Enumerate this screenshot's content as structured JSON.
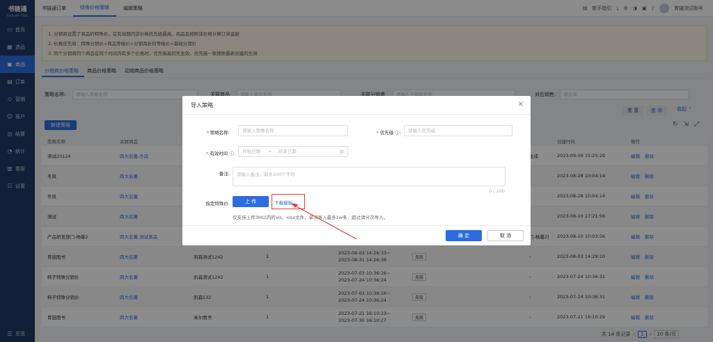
{
  "sidebar": {
    "logo_title": "书链通",
    "logo_sub": "SHULIAN TONG",
    "items": [
      {
        "label": "首页",
        "icon": "monitor-icon"
      },
      {
        "label": "选品",
        "icon": "grid-icon"
      },
      {
        "label": "商品",
        "icon": "box-icon"
      },
      {
        "label": "订单",
        "icon": "order-icon"
      },
      {
        "label": "营销",
        "icon": "marketing-icon"
      },
      {
        "label": "客户",
        "icon": "user-icon"
      },
      {
        "label": "结算",
        "icon": "settle-icon"
      },
      {
        "label": "统计",
        "icon": "chart-icon"
      },
      {
        "label": "看板",
        "icon": "board-icon"
      },
      {
        "label": "设置",
        "icon": "settings-icon"
      }
    ],
    "active_index": 2,
    "bottom_label": "总览"
  },
  "topbar": {
    "tabs": [
      "书链通订单",
      "特殊价格策略",
      "编辑策略"
    ],
    "active_tab": 1,
    "guide": "新手指引",
    "user": "育链测试账号"
  },
  "notice": [
    "1. 分销商设置了商品的特殊价，在有效期内该价格优先级最高，商品会按照该价格计算订单金额",
    "2. 价格优先级：特殊分销价>商品等级价>分销商折扣等级价>基础分销价",
    "3. 同个分销商同个商品在同个时间内有多个价格时，优先级高的先生效，优先级一致按照最新创建的生效"
  ],
  "subtabs": [
    "分销商价格策略",
    "商品价格策略",
    "动销商品价格策略"
  ],
  "search": {
    "name_label": "策略名称:",
    "name_ph": "请输入策略名称",
    "goods_label": "关联商品",
    "goods_ph": "请输入商品名称",
    "dist_label": "关联分销商",
    "dist_ph": "请输入分销商名称",
    "sales_label": "对应销售:",
    "sales_ph": "请选择"
  },
  "buttons": {
    "reset": "重 置",
    "query": "查 询",
    "collapse": "收起 ⌃",
    "new": "新建策略"
  },
  "table": {
    "headers": [
      "策略名称",
      "关联商品",
      "",
      "",
      "",
      "",
      "",
      "创建时间",
      "操作"
    ],
    "action_edit": "编辑",
    "action_delete": "删除",
    "rows": [
      {
        "name": "测试23124",
        "goods": "四大名著,冬风",
        "dist": "",
        "n": "",
        "period1": "",
        "period2": "",
        "status": "",
        "extra": "生成",
        "created": "2023-09-06 15:25:29"
      },
      {
        "name": "冬风",
        "goods": "四大名著",
        "dist": "",
        "n": "",
        "period1": "",
        "period2": "",
        "status": "",
        "extra": "",
        "created": "2023-08-28 10:04:14"
      },
      {
        "name": "冬风",
        "goods": "四大名著",
        "dist": "",
        "n": "",
        "period1": "",
        "period2": "",
        "status": "",
        "extra": "",
        "created": "2023-08-28 10:04:14"
      },
      {
        "name": "测试",
        "goods": "四大名著",
        "dist": "",
        "n": "",
        "period1": "",
        "period2": "",
        "status": "",
        "extra": "",
        "created": "2023-08-10 17:21:56"
      },
      {
        "name": "产品研发部门-杨馨2",
        "goods": "四大名著,测试商品",
        "dist": "",
        "n": "",
        "period1": "",
        "period2": "",
        "status": "",
        "extra": "门-杨馨2]",
        "created": "2023-08-10 10:03:56"
      },
      {
        "name": "育链图书",
        "goods": "四大名著",
        "dist": "凯森测试1242",
        "n": "1",
        "period1": "2023-08-03 14:26:33~",
        "period2": "2023-08-31 14:26:38",
        "status": "无效",
        "extra": "-",
        "created": "2023-08-03 14:29:10"
      },
      {
        "name": "柿子特殊分销价",
        "goods": "四大名著",
        "dist": "凯森测试1242",
        "n": "1",
        "period1": "2023-07-03 10:36:16~",
        "period2": "2023-07-24 10:36:24",
        "status": "无效",
        "extra": "-",
        "created": "2023-07-24 10:36:31"
      },
      {
        "name": "柿子特殊分销价",
        "goods": "四大名著",
        "dist": "凯森532",
        "n": "1",
        "period1": "2023-07-03 10:36:16~",
        "period2": "2023-07-24 10:36:24",
        "status": "无效",
        "extra": "-",
        "created": "2023-07-24 10:36:31"
      },
      {
        "name": "育链图书",
        "goods": "四大名著",
        "dist": "米尔图书",
        "n": "1",
        "period1": "2023-07-21 16:10:23~",
        "period2": "2023-07-30 16:10:27",
        "status": "无效",
        "extra": "-",
        "created": "2023-07-21 16:10:29"
      }
    ]
  },
  "footer": {
    "total": "共 14 条记录",
    "page": "1",
    "size": "20 条/页"
  },
  "modal": {
    "title": "导入策略",
    "name_label": "策略名称:",
    "name_ph": "请输入策略名称",
    "priority_label": "优先级",
    "priority_ph": "请输入优先级",
    "period_label": "有效时间",
    "start_ph": "开始日期",
    "end_ph": "结束日期",
    "remark_label": "备注:",
    "remark_ph": "请输入备注，最多200个字符",
    "counter": "0 / 200",
    "price_label": "指定特殊价:",
    "upload": "上 传",
    "download": "下载模板",
    "hint": "仅支持上传3M以内的xls、xlsx文件，单次导入最多1w条，超过请分次导入。",
    "ok": "确 定",
    "cancel": "取 消"
  }
}
